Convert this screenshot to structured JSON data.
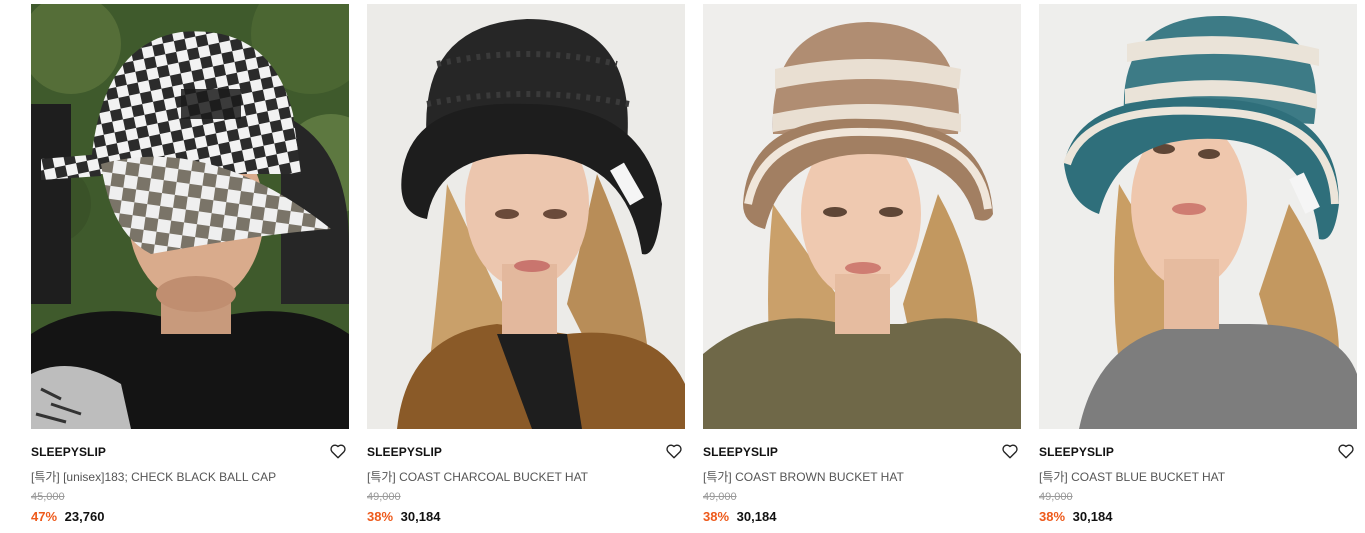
{
  "colors": {
    "discount": "#ee5a1b",
    "original_price": "#999999",
    "product_name": "#555555",
    "brand": "#111111"
  },
  "products": [
    {
      "brand": "SLEEPYSLIP",
      "name": "[특가] [unisex]183; CHECK BLACK BALL CAP",
      "original_price": "45,000",
      "discount": "47%",
      "sale_price": "23,760",
      "image": "checkered-ball-cap-photo",
      "wishlist_icon": "heart-icon"
    },
    {
      "brand": "SLEEPYSLIP",
      "name": "[특가] COAST CHARCOAL BUCKET HAT",
      "original_price": "49,000",
      "discount": "38%",
      "sale_price": "30,184",
      "image": "charcoal-bucket-hat-photo",
      "wishlist_icon": "heart-icon"
    },
    {
      "brand": "SLEEPYSLIP",
      "name": "[특가] COAST BROWN BUCKET HAT",
      "original_price": "49,000",
      "discount": "38%",
      "sale_price": "30,184",
      "image": "brown-bucket-hat-photo",
      "wishlist_icon": "heart-icon"
    },
    {
      "brand": "SLEEPYSLIP",
      "name": "[특가] COAST BLUE BUCKET HAT",
      "original_price": "49,000",
      "discount": "38%",
      "sale_price": "30,184",
      "image": "blue-bucket-hat-photo",
      "wishlist_icon": "heart-icon"
    }
  ]
}
